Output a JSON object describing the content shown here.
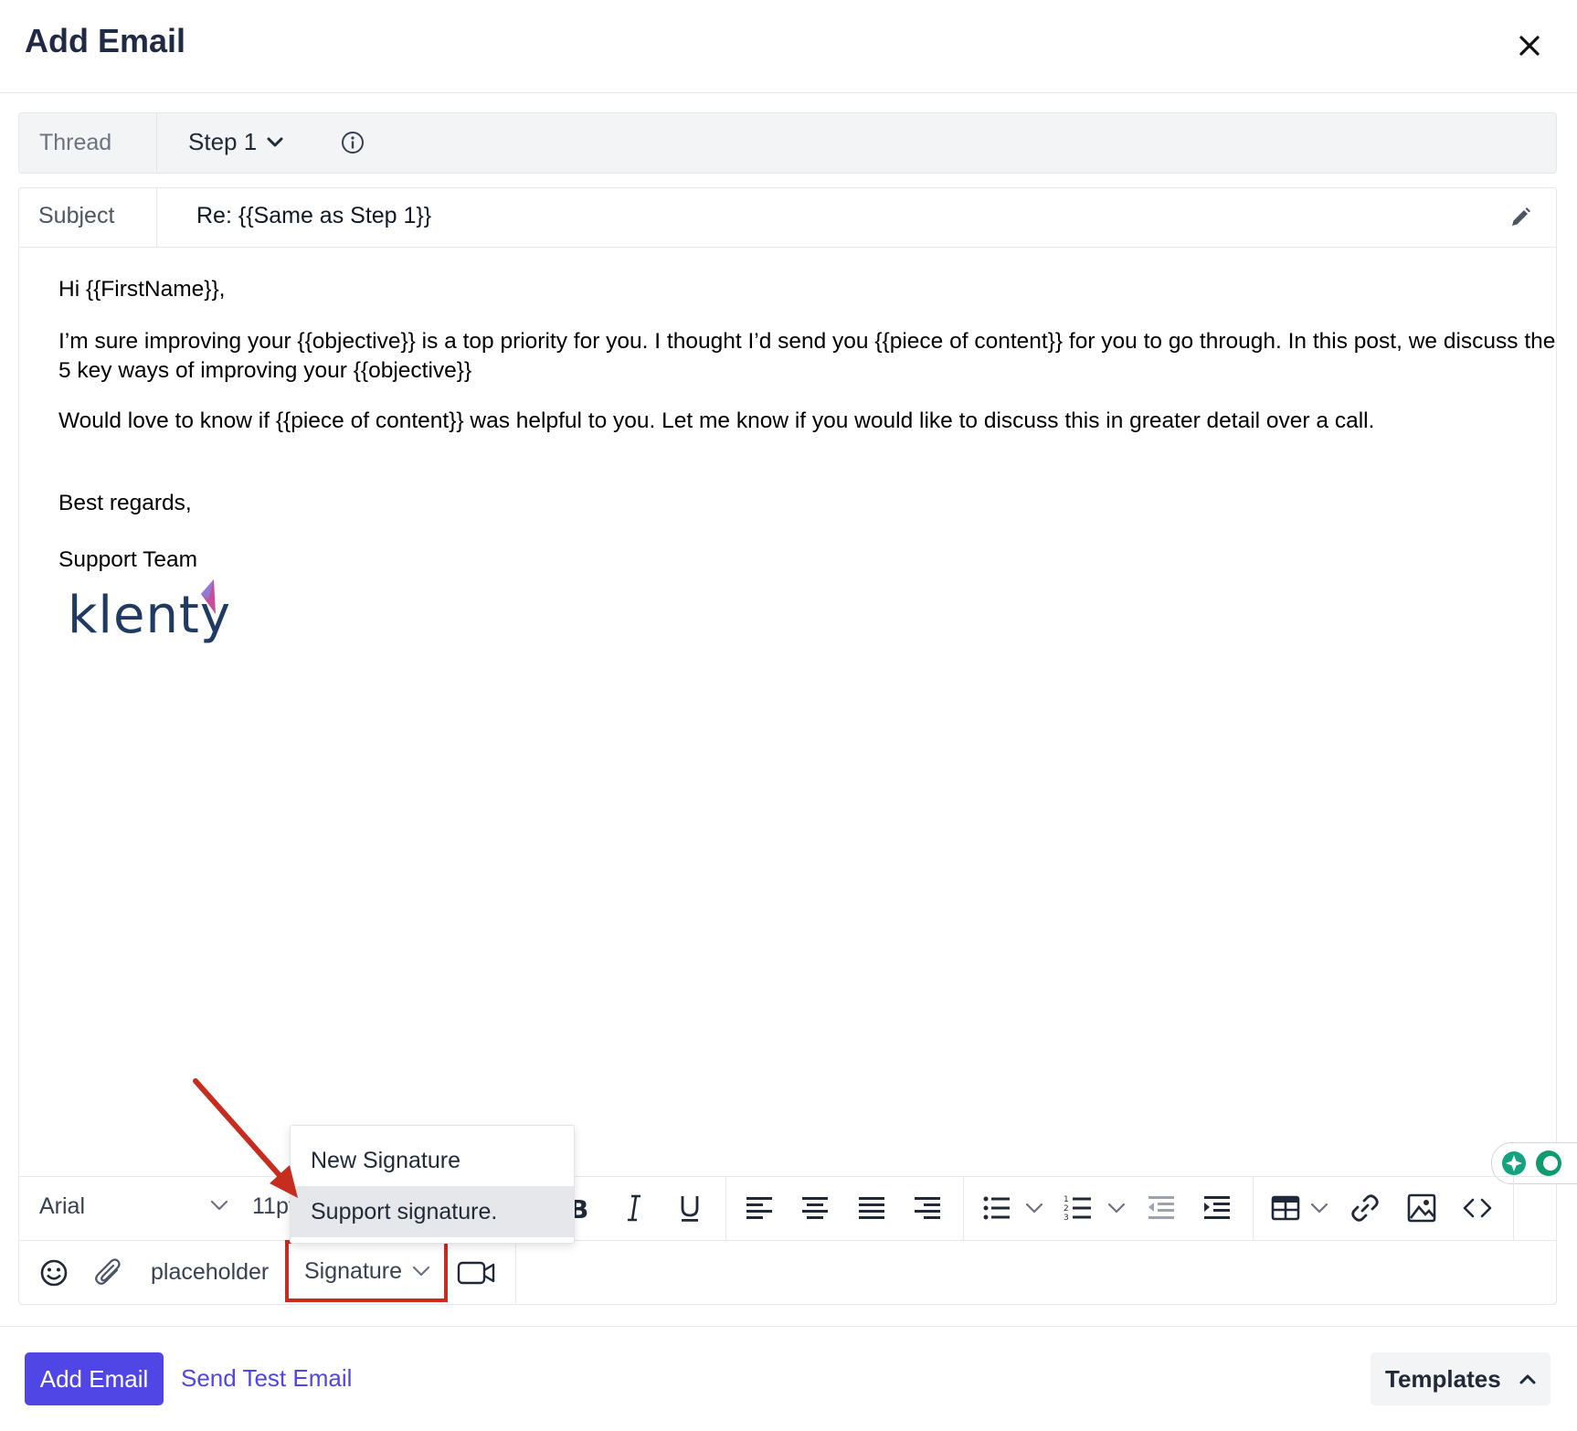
{
  "modal": {
    "title": "Add Email"
  },
  "thread": {
    "label": "Thread",
    "step_value": "Step 1"
  },
  "subject": {
    "label": "Subject",
    "value": "Re: {{Same as Step 1}}"
  },
  "body": {
    "greeting": "Hi {{FirstName}},",
    "paragraph1": "I’m sure improving your {{objective}} is a top priority for you. I thought I’d send you {{piece of content}} for you to go through. In this post, we discuss the 5 key ways of improving your {{objective}}",
    "paragraph2": "Would love to know if {{piece of content}} was helpful to you. Let me know if you would like to discuss this in greater detail over a call.",
    "closing": "Best regards,",
    "signature_name": "Support Team",
    "logo_text": "klenty"
  },
  "toolbar": {
    "font": "Arial",
    "font_size": "11pt",
    "icons": [
      "bold-icon",
      "italic-icon",
      "underline-icon",
      "align-left-icon",
      "align-center-icon",
      "align-justify-icon",
      "align-right-icon",
      "bullet-list-icon",
      "numbered-list-icon",
      "outdent-icon",
      "indent-icon",
      "table-icon",
      "link-icon",
      "image-icon",
      "code-icon"
    ]
  },
  "bottom_bar": {
    "placeholder_label": "placeholder",
    "signature_label": "Signature"
  },
  "signature_dropdown": {
    "items": [
      "New Signature",
      "Support signature."
    ],
    "highlighted": "Support signature."
  },
  "footer": {
    "primary_label": "Add Email",
    "test_label": "Send Test Email",
    "templates_label": "Templates"
  },
  "colors": {
    "primary": "#4f46e5",
    "annotation_red": "#c62d1f"
  }
}
